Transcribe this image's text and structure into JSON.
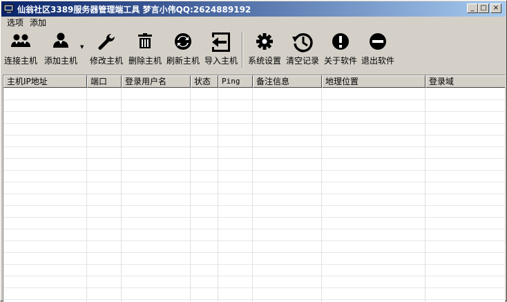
{
  "window": {
    "title": "仙翁社区3389服务器管理端工具  梦言小伟QQ:2624889192",
    "controls": {
      "minimize": "_",
      "maximize": "□",
      "close": "×"
    }
  },
  "menu": {
    "items": [
      "选项",
      "添加"
    ]
  },
  "toolbar": {
    "connect_host": "连接主机",
    "add_host": "添加主机",
    "edit_host": "修改主机",
    "delete_host": "删除主机",
    "refresh_host": "刷新主机",
    "import_host": "导入主机",
    "system_settings": "系统设置",
    "clear_records": "清空记录",
    "about_software": "关于软件",
    "exit_software": "退出软件"
  },
  "table": {
    "columns": [
      "主机IP地址",
      "端口",
      "登录用户名",
      "状态",
      "Ping",
      "备注信息",
      "地理位置",
      "登录域"
    ],
    "rows": []
  }
}
